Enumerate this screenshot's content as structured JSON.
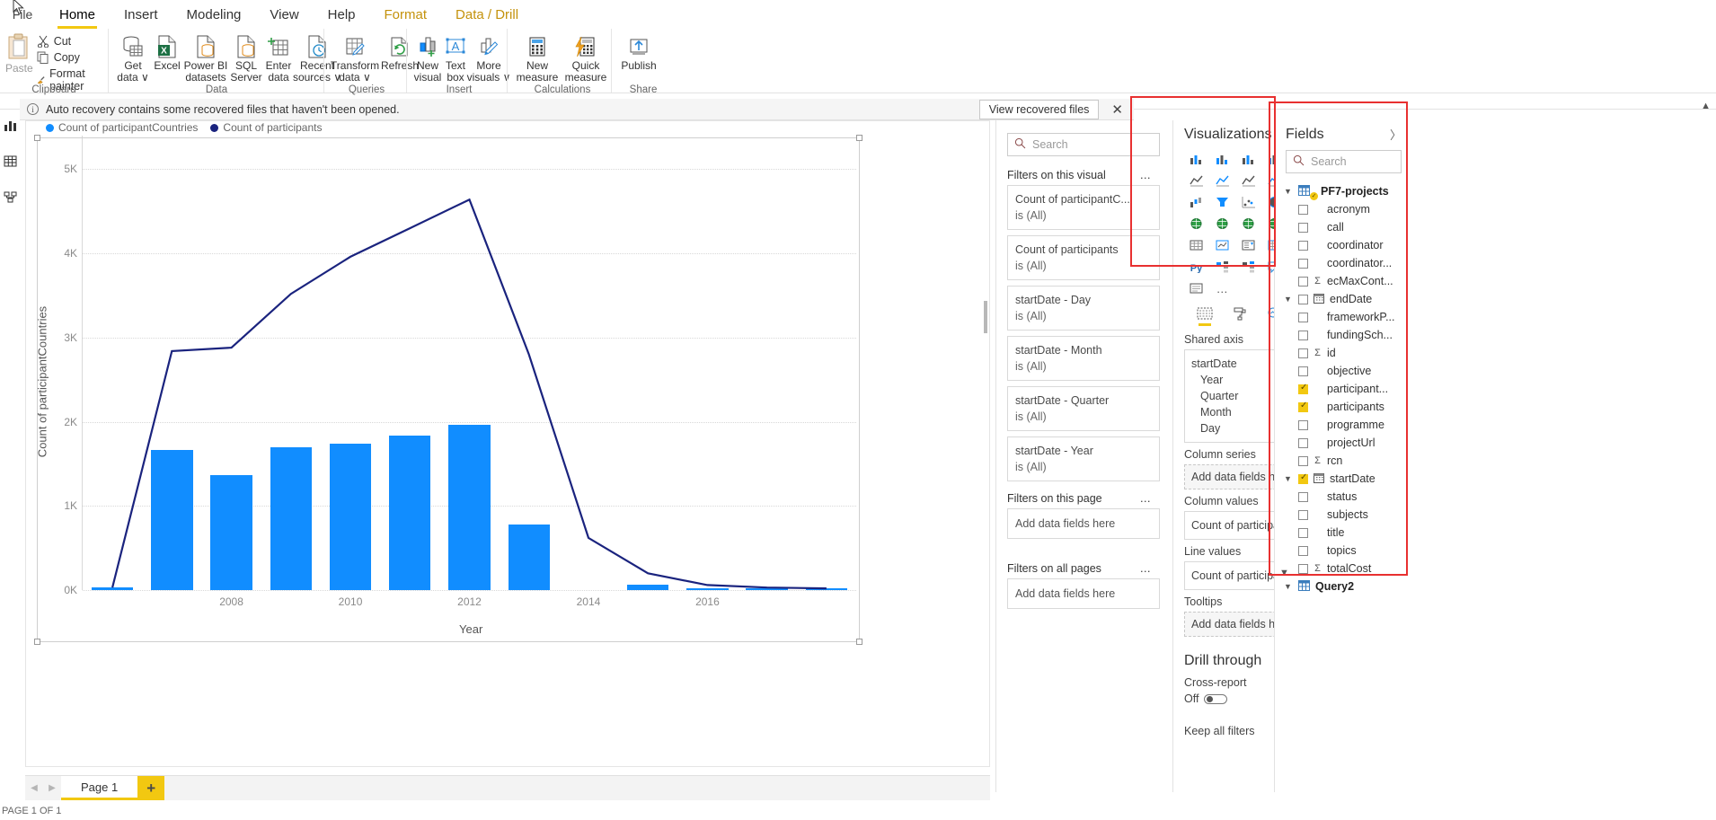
{
  "window": {
    "file_menu": "File"
  },
  "ribbon": {
    "tabs": [
      {
        "label": "Home",
        "active": true,
        "contextual": false
      },
      {
        "label": "Insert",
        "active": false,
        "contextual": false
      },
      {
        "label": "Modeling",
        "active": false,
        "contextual": false
      },
      {
        "label": "View",
        "active": false,
        "contextual": false
      },
      {
        "label": "Help",
        "active": false,
        "contextual": false
      },
      {
        "label": "Format",
        "active": false,
        "contextual": true
      },
      {
        "label": "Data / Drill",
        "active": false,
        "contextual": true
      }
    ],
    "clipboard": {
      "group_label": "Clipboard",
      "paste": "Paste",
      "cut": "Cut",
      "copy": "Copy",
      "format_painter": "Format painter"
    },
    "data": {
      "group_label": "Data",
      "items": [
        {
          "line1": "Get",
          "line2": "data ∨",
          "icon": "database-icon"
        },
        {
          "line1": "Excel",
          "line2": "",
          "icon": "excel-icon"
        },
        {
          "line1": "Power BI",
          "line2": "datasets",
          "icon": "powerbi-dataset-icon"
        },
        {
          "line1": "SQL",
          "line2": "Server",
          "icon": "sql-server-icon"
        },
        {
          "line1": "Enter",
          "line2": "data",
          "icon": "enter-data-icon"
        },
        {
          "line1": "Recent",
          "line2": "sources ∨",
          "icon": "recent-sources-icon"
        }
      ]
    },
    "queries": {
      "group_label": "Queries",
      "items": [
        {
          "line1": "Transform",
          "line2": "data ∨",
          "icon": "transform-data-icon"
        },
        {
          "line1": "Refresh",
          "line2": "",
          "icon": "refresh-icon"
        }
      ]
    },
    "insert": {
      "group_label": "Insert",
      "items": [
        {
          "line1": "New",
          "line2": "visual",
          "icon": "new-visual-icon"
        },
        {
          "line1": "Text",
          "line2": "box",
          "icon": "text-box-icon"
        },
        {
          "line1": "More",
          "line2": "visuals ∨",
          "icon": "more-visuals-icon"
        }
      ]
    },
    "calculations": {
      "group_label": "Calculations",
      "items": [
        {
          "line1": "New",
          "line2": "measure",
          "icon": "new-measure-icon"
        },
        {
          "line1": "Quick",
          "line2": "measure",
          "icon": "quick-measure-icon"
        }
      ]
    },
    "share": {
      "group_label": "Share",
      "items": [
        {
          "line1": "Publish",
          "line2": "",
          "icon": "publish-icon"
        }
      ]
    }
  },
  "notification": {
    "icon": "info-icon",
    "message": "Auto recovery contains some recovered files that haven't been opened.",
    "button": "View recovered files",
    "close": "✕"
  },
  "left_rail": {
    "items": [
      {
        "icon": "report-view-icon",
        "label": "Report"
      },
      {
        "icon": "data-view-icon",
        "label": "Data"
      },
      {
        "icon": "model-view-icon",
        "label": "Model"
      }
    ]
  },
  "chart_data": {
    "type": "bar",
    "title": "",
    "xlabel": "Year",
    "ylabel": "Count of participantCountries",
    "ylim": [
      0,
      5400
    ],
    "yticks": [
      0,
      1000,
      2000,
      3000,
      4000,
      5000
    ],
    "ytick_labels": [
      "0K",
      "1K",
      "2K",
      "3K",
      "4K",
      "5K"
    ],
    "grid": true,
    "legend_position": "top-left",
    "legend": [
      {
        "name": "Count of participantCountries",
        "color": "#118dff"
      },
      {
        "name": "Count of participants",
        "color": "#1a237e"
      }
    ],
    "categories": [
      2006,
      2007,
      2008,
      2009,
      2010,
      2011,
      2012,
      2013,
      2014,
      2015,
      2016,
      2017,
      2018
    ],
    "xtick_labels": [
      "2008",
      "2010",
      "2012",
      "2014",
      "2016"
    ],
    "xticks": [
      2008,
      2010,
      2012,
      2014,
      2016
    ],
    "series": [
      {
        "name": "Count of participantCountries",
        "type": "column",
        "color": "#118dff",
        "values": [
          30,
          1660,
          1370,
          1700,
          1740,
          1840,
          1960,
          780,
          0,
          60,
          20,
          10,
          10
        ]
      },
      {
        "name": "Count of participants",
        "type": "line",
        "color": "#1a237e",
        "values": [
          30,
          2840,
          2880,
          3520,
          3960,
          4300,
          4640,
          2800,
          620,
          200,
          60,
          30,
          20
        ]
      }
    ]
  },
  "page_tabs": {
    "prev": "◀",
    "next": "▶",
    "tabs": [
      {
        "label": "Page 1",
        "active": true
      }
    ],
    "add": "+"
  },
  "status_bar": {
    "text": "PAGE 1 OF 1"
  },
  "filters_pane": {
    "search_placeholder": "Search",
    "sections": [
      {
        "title": "Filters on this visual",
        "menu": "…",
        "cards": [
          {
            "field": "Count of participantC...",
            "state": "is (All)"
          },
          {
            "field": "Count of participants",
            "state": "is (All)"
          },
          {
            "field": "startDate - Day",
            "state": "is (All)"
          },
          {
            "field": "startDate - Month",
            "state": "is (All)"
          },
          {
            "field": "startDate - Quarter",
            "state": "is (All)"
          },
          {
            "field": "startDate - Year",
            "state": "is (All)"
          }
        ]
      },
      {
        "title": "Filters on this page",
        "menu": "…",
        "cards": [],
        "dropzone": "Add data fields here"
      },
      {
        "title": "Filters on all pages",
        "menu": "…",
        "cards": [],
        "dropzone": "Add data fields here"
      }
    ]
  },
  "visualizations_pane": {
    "title": "Visualizations",
    "expand_icon": "chevron-right-icon",
    "icons": [
      "stacked-bar-chart-icon",
      "clustered-bar-chart-icon",
      "stacked-column-chart-icon",
      "clustered-column-chart-icon",
      "100-stacked-bar-chart-icon",
      "100-stacked-column-chart-icon",
      "line-chart-icon",
      "area-chart-icon",
      "stacked-area-chart-icon",
      "line-stacked-column-chart-icon",
      "line-clustered-column-chart-icon",
      "ribbon-chart-icon",
      "waterfall-chart-icon",
      "funnel-chart-icon",
      "scatter-chart-icon",
      "pie-chart-icon",
      "donut-chart-icon",
      "treemap-icon",
      "map-icon",
      "filled-map-icon",
      "shape-map-icon",
      "azure-map-icon",
      "gauge-icon",
      "card-icon",
      "multi-row-card-icon",
      "kpi-icon",
      "slicer-icon",
      "table-icon",
      "matrix-icon",
      "r-script-visual-icon",
      "python-visual-icon",
      "key-influencers-icon",
      "decomposition-tree-icon",
      "qna-icon",
      "smart-narrative-icon",
      "paginated-report-icon",
      "get-more-visuals-icon"
    ],
    "bottom_icons": [
      "selected-visual-icon",
      "format-paint-roller-icon",
      "analytics-magnifier-icon"
    ],
    "wells": [
      {
        "label": "Shared axis",
        "type": "fields",
        "items": [
          {
            "text": "startDate",
            "chevron": "∨",
            "sub": false
          },
          {
            "text": "Year",
            "remove": "✕",
            "sub": true
          },
          {
            "text": "Quarter",
            "remove": "✕",
            "sub": true
          },
          {
            "text": "Month",
            "remove": "✕",
            "sub": true
          },
          {
            "text": "Day",
            "remove": "✕",
            "sub": true
          }
        ]
      },
      {
        "label": "Column series",
        "type": "empty",
        "placeholder": "Add data fields here"
      },
      {
        "label": "Column values",
        "type": "fields",
        "items": [
          {
            "text": "Count of participantCou",
            "chevron": "∨",
            "remove": "✕",
            "sub": false
          }
        ]
      },
      {
        "label": "Line values",
        "type": "fields",
        "items": [
          {
            "text": "Count of participants",
            "chevron": "∨",
            "remove": "✕",
            "sub": false
          }
        ]
      },
      {
        "label": "Tooltips",
        "type": "empty",
        "placeholder": "Add data fields here"
      }
    ],
    "drill_through": {
      "title": "Drill through",
      "cross_report_label": "Cross-report",
      "cross_report_state": "Off",
      "keep_all_filters": "Keep all filters"
    }
  },
  "fields_pane": {
    "title": "Fields",
    "expand_icon": "chevron-right-icon",
    "search_placeholder": "Search",
    "tables": [
      {
        "name": "PF7-projects",
        "expanded": true,
        "icon": "table-icon",
        "checked": true,
        "fields": [
          {
            "name": "acronym",
            "checked": false,
            "measure": false,
            "date": false,
            "expandable": false
          },
          {
            "name": "call",
            "checked": false,
            "measure": false,
            "date": false,
            "expandable": false
          },
          {
            "name": "coordinator",
            "checked": false,
            "measure": false,
            "date": false,
            "expandable": false
          },
          {
            "name": "coordinator...",
            "checked": false,
            "measure": false,
            "date": false,
            "expandable": false
          },
          {
            "name": "ecMaxCont...",
            "checked": false,
            "measure": true,
            "date": false,
            "expandable": false
          },
          {
            "name": "endDate",
            "checked": false,
            "measure": false,
            "date": true,
            "expandable": true
          },
          {
            "name": "frameworkP...",
            "checked": false,
            "measure": false,
            "date": false,
            "expandable": false
          },
          {
            "name": "fundingSch...",
            "checked": false,
            "measure": false,
            "date": false,
            "expandable": false
          },
          {
            "name": "id",
            "checked": false,
            "measure": true,
            "date": false,
            "expandable": false
          },
          {
            "name": "objective",
            "checked": false,
            "measure": false,
            "date": false,
            "expandable": false
          },
          {
            "name": "participant...",
            "checked": true,
            "measure": false,
            "date": false,
            "expandable": false
          },
          {
            "name": "participants",
            "checked": true,
            "measure": false,
            "date": false,
            "expandable": false
          },
          {
            "name": "programme",
            "checked": false,
            "measure": false,
            "date": false,
            "expandable": false
          },
          {
            "name": "projectUrl",
            "checked": false,
            "measure": false,
            "date": false,
            "expandable": false
          },
          {
            "name": "rcn",
            "checked": false,
            "measure": true,
            "date": false,
            "expandable": false
          },
          {
            "name": "startDate",
            "checked": true,
            "measure": false,
            "date": true,
            "expandable": true
          },
          {
            "name": "status",
            "checked": false,
            "measure": false,
            "date": false,
            "expandable": false
          },
          {
            "name": "subjects",
            "checked": false,
            "measure": false,
            "date": false,
            "expandable": false
          },
          {
            "name": "title",
            "checked": false,
            "measure": false,
            "date": false,
            "expandable": false
          },
          {
            "name": "topics",
            "checked": false,
            "measure": false,
            "date": false,
            "expandable": false
          },
          {
            "name": "totalCost",
            "checked": false,
            "measure": true,
            "date": false,
            "expandable": false
          }
        ]
      },
      {
        "name": "Query2",
        "expanded": true,
        "icon": "table-icon",
        "checked": false,
        "fields": []
      }
    ]
  },
  "colors": {
    "accent": "#f2c811",
    "bar": "#118dff",
    "line": "#1a237e",
    "highlight_box": "#e83030"
  }
}
